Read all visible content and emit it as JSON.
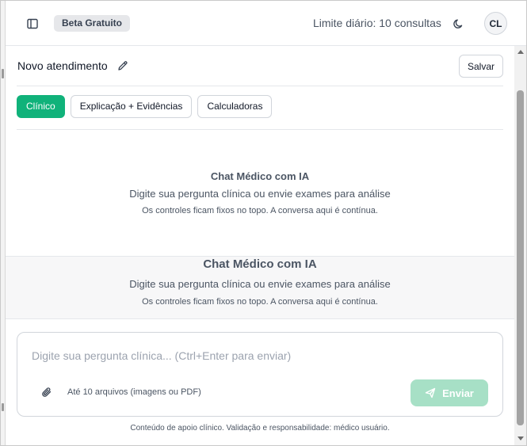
{
  "header": {
    "badge": "Beta Gratuito",
    "limit_text": "Limite diário: 10 consultas",
    "avatar_initials": "CL",
    "sidebar_icon": "sidebar-panel-icon",
    "theme_icon": "moon-icon"
  },
  "session": {
    "title": "Novo atendimento",
    "edit_icon": "pencil-icon",
    "save_label": "Salvar"
  },
  "tabs": [
    {
      "label": "Clínico",
      "active": true
    },
    {
      "label": "Explicação + Evidências",
      "active": false
    },
    {
      "label": "Calculadoras",
      "active": false
    }
  ],
  "empty_state": {
    "title": "Chat Médico com IA",
    "subtitle": "Digite sua pergunta clínica ou envie exames para análise",
    "note": "Os controles ficam fixos no topo. A conversa aqui é contínua."
  },
  "composer": {
    "placeholder": "Digite sua pergunta clínica... (Ctrl+Enter para enviar)",
    "attach_icon": "paperclip-icon",
    "attach_hint": "Até 10 arquivos (imagens ou PDF)",
    "send_label": "Enviar",
    "send_icon": "send-icon"
  },
  "footer": {
    "disclaimer": "Conteúdo de apoio clínico. Validação e responsabilidade: médico usuário."
  },
  "colors": {
    "accent": "#10b27a",
    "send_disabled": "#a7e0c6"
  }
}
